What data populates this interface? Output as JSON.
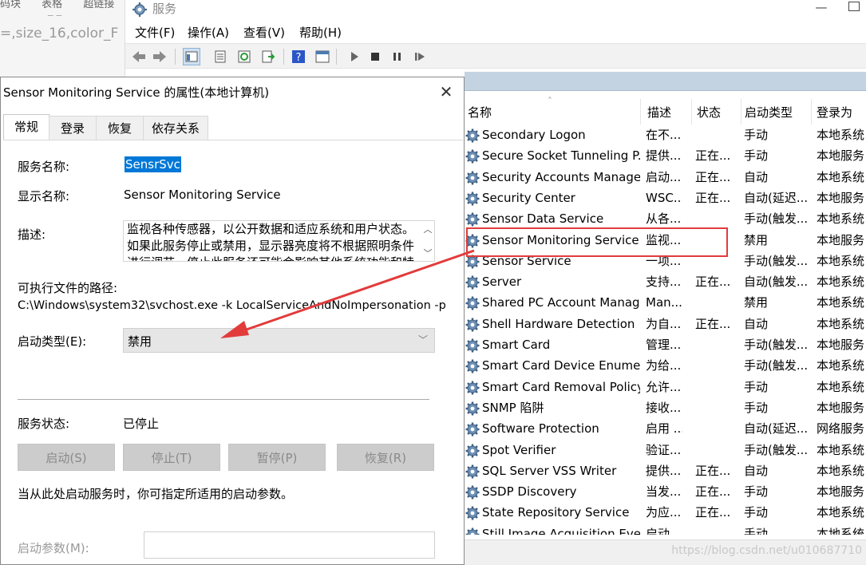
{
  "background_editor": {
    "tabs": [
      "码块",
      "表格",
      "超链接"
    ],
    "code_text": "=,size_16,color_F"
  },
  "services_window": {
    "title": "服务",
    "menu": [
      "文件(F)",
      "操作(A)",
      "查看(V)",
      "帮助(H)"
    ],
    "columns": {
      "name": "名称",
      "description": "描述",
      "status": "状态",
      "startup_type": "启动类型",
      "log_on_as": "登录为"
    },
    "rows": [
      {
        "name": "Secondary Logon",
        "desc": "在不...",
        "status": "",
        "startup": "手动",
        "logon": "本地系统"
      },
      {
        "name": "Secure Socket Tunneling P...",
        "desc": "提供...",
        "status": "正在...",
        "startup": "手动",
        "logon": "本地服务"
      },
      {
        "name": "Security Accounts Manager",
        "desc": "启动...",
        "status": "正在...",
        "startup": "自动",
        "logon": "本地系统"
      },
      {
        "name": "Security Center",
        "desc": "WSC...",
        "status": "正在...",
        "startup": "自动(延迟...",
        "logon": "本地服务"
      },
      {
        "name": "Sensor Data Service",
        "desc": "从各...",
        "status": "",
        "startup": "手动(触发...",
        "logon": "本地系统"
      },
      {
        "name": "Sensor Monitoring Service",
        "desc": "监视...",
        "status": "",
        "startup": "禁用",
        "logon": "本地服务"
      },
      {
        "name": "Sensor Service",
        "desc": "一项...",
        "status": "",
        "startup": "手动(触发...",
        "logon": "本地系统"
      },
      {
        "name": "Server",
        "desc": "支持...",
        "status": "正在...",
        "startup": "自动(触发...",
        "logon": "本地系统"
      },
      {
        "name": "Shared PC Account Manager",
        "desc": "Man...",
        "status": "",
        "startup": "禁用",
        "logon": "本地系统"
      },
      {
        "name": "Shell Hardware Detection",
        "desc": "为自...",
        "status": "正在...",
        "startup": "自动",
        "logon": "本地系统"
      },
      {
        "name": "Smart Card",
        "desc": "管理...",
        "status": "",
        "startup": "手动(触发...",
        "logon": "本地服务"
      },
      {
        "name": "Smart Card Device Enumer...",
        "desc": "为给...",
        "status": "",
        "startup": "手动(触发...",
        "logon": "本地系统"
      },
      {
        "name": "Smart Card Removal Policy",
        "desc": "允许...",
        "status": "",
        "startup": "手动",
        "logon": "本地系统"
      },
      {
        "name": "SNMP 陷阱",
        "desc": "接收...",
        "status": "",
        "startup": "手动",
        "logon": "本地服务"
      },
      {
        "name": "Software Protection",
        "desc": "启用 ...",
        "status": "",
        "startup": "自动(延迟...",
        "logon": "网络服务"
      },
      {
        "name": "Spot Verifier",
        "desc": "验证...",
        "status": "",
        "startup": "手动(触发...",
        "logon": "本地系统"
      },
      {
        "name": "SQL Server VSS Writer",
        "desc": "提供...",
        "status": "正在...",
        "startup": "自动",
        "logon": "本地系统"
      },
      {
        "name": "SSDP Discovery",
        "desc": "当发...",
        "status": "正在...",
        "startup": "手动",
        "logon": "本地服务"
      },
      {
        "name": "State Repository Service",
        "desc": "为应...",
        "status": "正在...",
        "startup": "手动",
        "logon": "本地系统"
      },
      {
        "name": "Still Image Acquisition Eve...",
        "desc": "启动...",
        "status": "",
        "startup": "手动",
        "logon": "本地系统"
      }
    ],
    "watermark": "https://blog.csdn.net/u010687710"
  },
  "dialog": {
    "title": "Sensor Monitoring Service 的属性(本地计算机)",
    "tabs": [
      "常规",
      "登录",
      "恢复",
      "依存关系"
    ],
    "service_name_label": "服务名称:",
    "service_name_value": "SensrSvc",
    "display_name_label": "显示名称:",
    "display_name_value": "Sensor Monitoring Service",
    "description_label": "描述:",
    "description_text": "监视各种传感器，以公开数据和适应系统和用户状态。如果此服务停止或禁用，显示器亮度将不根据照明条件进行调节。停止此服务还可能会影响其他系统功能和特",
    "exe_path_label": "可执行文件的路径:",
    "exe_path_value": "C:\\Windows\\system32\\svchost.exe -k LocalServiceAndNoImpersonation -p",
    "startup_type_label": "启动类型(E):",
    "startup_type_value": "禁用",
    "service_status_label": "服务状态:",
    "service_status_value": "已停止",
    "buttons": {
      "start": "启动(S)",
      "stop": "停止(T)",
      "pause": "暂停(P)",
      "resume": "恢复(R)"
    },
    "hint_text": "当从此处启动服务时，你可指定所适用的启动参数。",
    "start_params_label": "启动参数(M):",
    "start_params_value": ""
  },
  "colors": {
    "selection_blue": "#0078d7",
    "annotation_red": "#e23b3b",
    "disabled_button": "#cccccc",
    "list_band": "#c4d3e2"
  }
}
